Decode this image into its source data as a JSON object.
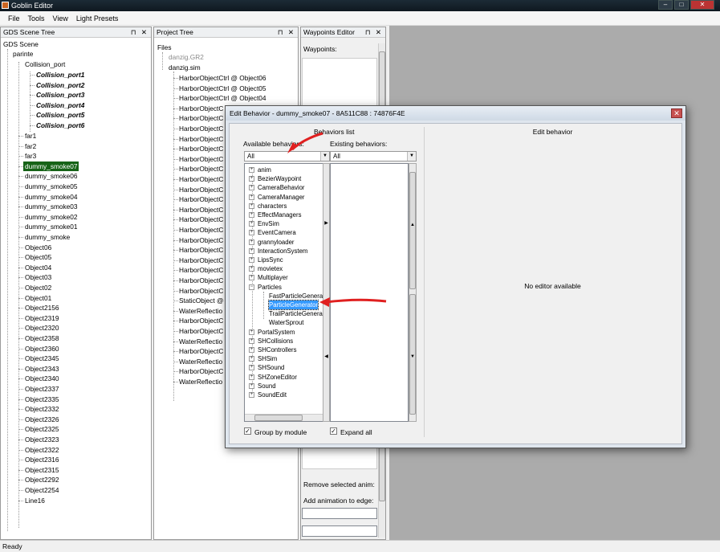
{
  "window": {
    "title": "Goblin Editor",
    "min": "–",
    "max": "□",
    "close": "✕"
  },
  "menu": [
    "File",
    "Tools",
    "View",
    "Light Presets"
  ],
  "scene_panel": {
    "title": "GDS Scene Tree",
    "root": "GDS Scene",
    "parent": "parinte",
    "collision": "Collision_port",
    "collision_children": [
      "Collision_port1",
      "Collision_port2",
      "Collision_port3",
      "Collision_port4",
      "Collision_port5",
      "Collision_port6"
    ],
    "items": [
      "far1",
      "far2",
      "far3",
      "dummy_smoke07",
      "dummy_smoke06",
      "dummy_smoke05",
      "dummy_smoke04",
      "dummy_smoke03",
      "dummy_smoke02",
      "dummy_smoke01",
      "dummy_smoke",
      "Object06",
      "Object05",
      "Object04",
      "Object03",
      "Object02",
      "Object01",
      "Object2156",
      "Object2319",
      "Object2320",
      "Object2358",
      "Object2360",
      "Object2345",
      "Object2343",
      "Object2340",
      "Object2337",
      "Object2335",
      "Object2332",
      "Object2326",
      "Object2325",
      "Object2323",
      "Object2322",
      "Object2316",
      "Object2315",
      "Object2292",
      "Object2254",
      "Line16"
    ],
    "selected": "dummy_smoke07"
  },
  "project_panel": {
    "title": "Project Tree",
    "files": "Files",
    "gr2": "danzig.GR2",
    "sim": "danzig.sim",
    "items": [
      "HarborObjectCtrl @ Object06",
      "HarborObjectCtrl @ Object05",
      "HarborObjectCtrl @ Object04",
      "HarborObjectC",
      "HarborObjectC",
      "HarborObjectC",
      "HarborObjectC",
      "HarborObjectC",
      "HarborObjectC",
      "HarborObjectC",
      "HarborObjectC",
      "HarborObjectC",
      "HarborObjectC",
      "HarborObjectC",
      "HarborObjectC",
      "HarborObjectC",
      "HarborObjectC",
      "HarborObjectC",
      "HarborObjectC",
      "HarborObjectC",
      "HarborObjectC",
      "HarborObjectC",
      "StaticObject @",
      "WaterReflectio",
      "HarborObjectC",
      "HarborObjectC",
      "WaterReflectio",
      "HarborObjectC",
      "WaterReflectio",
      "HarborObjectC",
      "WaterReflectio"
    ]
  },
  "waypoints_panel": {
    "title": "Waypoints Editor",
    "waypoints_label": "Waypoints:",
    "remove_anim": "Remove selected anim:",
    "add_anim": "Add animation to edge:"
  },
  "dialog": {
    "title": "Edit Behavior - dummy_smoke07 - 8A511C88 : 74876F4E",
    "close": "✕",
    "behaviors_list": "Behaviors list",
    "available_label": "Available behaviors:",
    "existing_label": "Existing behaviors:",
    "available_filter": "All",
    "existing_filter": "All",
    "available": [
      "anim",
      "BezierWaypoint",
      "CameraBehavior",
      "CameraManager",
      "characters",
      "EffectManagers",
      "EnvSim",
      "EventCamera",
      "grannyloader",
      "InteractionSystem",
      "LipsSync",
      "movietex",
      "Multiplayer",
      "Particles"
    ],
    "particles_children": [
      "FastParticleGenerat",
      "ParticleGenerator",
      "TrailParticleGenerat",
      "WaterSprout"
    ],
    "available_after": [
      "PortalSystem",
      "SHCollisions",
      "SHControllers",
      "SHSim",
      "SHSound",
      "SHZoneEditor",
      "Sound",
      "SoundEdit"
    ],
    "selected": "ParticleGenerator",
    "group_by_module": "Group by module",
    "expand_all": "Expand all",
    "edit_behavior": "Edit behavior",
    "no_editor": "No editor available"
  },
  "panel_buttons": "⊓ ✕",
  "status": "Ready",
  "colors": {
    "selection": "#166317",
    "dialog_bg": "#dfe6ee",
    "workspace": "#ababab",
    "highlight": "#3399ff",
    "annotation": "#e02020"
  }
}
